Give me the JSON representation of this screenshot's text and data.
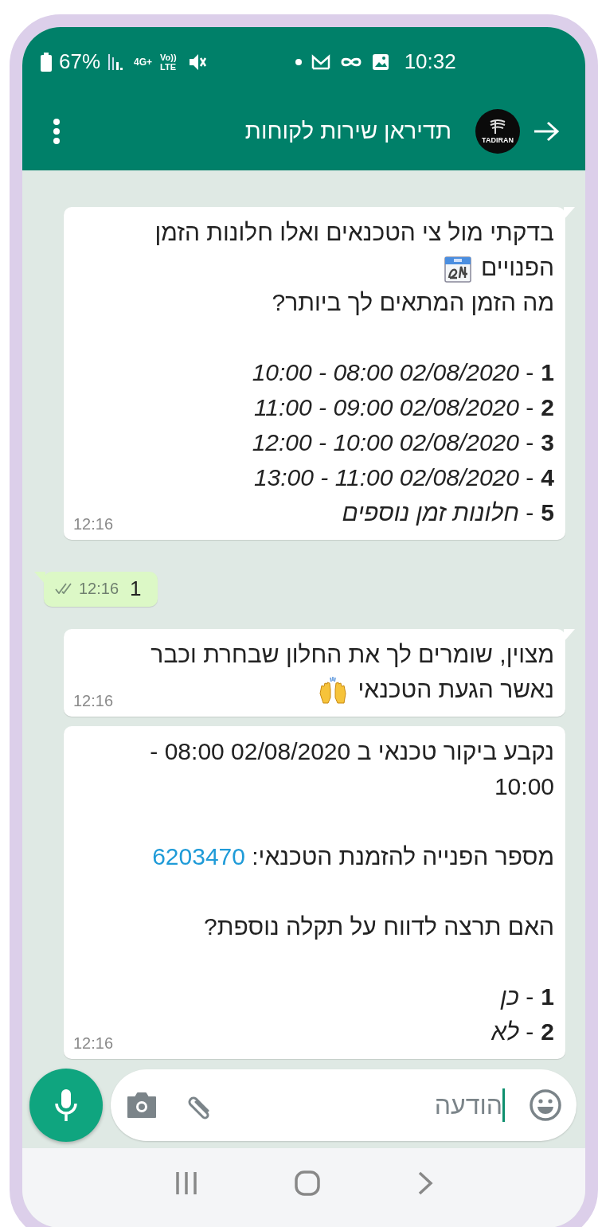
{
  "status_bar": {
    "battery": "67%",
    "network": "4G+",
    "volte": "Vo))",
    "lte": "LTE",
    "time": "10:32"
  },
  "header": {
    "title": "תדיראן שירות לקוחות",
    "avatar_text": "TADIRAN"
  },
  "messages": [
    {
      "kind": "incoming",
      "tail": true,
      "time": "12:16",
      "blocks": [
        {
          "kind": "text",
          "text": "בדקתי מול צי הטכנאים ואלו חלונות הזמן"
        },
        {
          "kind": "calendar",
          "text": "הפנויים"
        },
        {
          "kind": "text",
          "text": "מה הזמן המתאים לך ביותר?"
        },
        {
          "kind": "options",
          "items": [
            {
              "number": "1",
              "text": "- *02/08/2020 08:00 - 10:00*"
            },
            {
              "number": "2",
              "text": "- *02/08/2020 09:00 - 11:00*"
            },
            {
              "number": "3",
              "text": "- *02/08/2020 10:00 - 12:00*"
            },
            {
              "number": "4",
              "text": "- *02/08/2020 11:00 - 13:00*"
            },
            {
              "number": "5",
              "text": "- *חלונות זמן נוספים*"
            }
          ]
        }
      ]
    },
    {
      "kind": "outgoing",
      "tail": true,
      "time": "12:16",
      "read": false,
      "blocks": [
        {
          "kind": "text",
          "text": "1"
        }
      ]
    },
    {
      "kind": "incoming",
      "tail": true,
      "time": "12:16",
      "blocks": [
        {
          "kind": "text",
          "text": "מצוין, שומרים לך את החלון שבחרת וכבר"
        },
        {
          "kind": "cheer",
          "text": "נאשר הגעת הטכנאי"
        }
      ]
    },
    {
      "kind": "incoming",
      "tail": false,
      "time": "12:16",
      "blocks": [
        {
          "kind": "text",
          "text": "נקבע ביקור טכנאי ב 02/08/2020 08:00 - 10:00"
        },
        {
          "kind": "link_text",
          "text": "מספר הפנייה להזמנת הטכנאי:",
          "link": "6203470"
        },
        {
          "kind": "text",
          "text": "האם תרצה לדווח על תקלה נוספת?"
        },
        {
          "kind": "options",
          "items": [
            {
              "number": "1",
              "text": "- *כן*"
            },
            {
              "number": "2",
              "text": "- *לא*"
            }
          ]
        }
      ]
    }
  ],
  "composer": {
    "placeholder": "הודעה"
  }
}
